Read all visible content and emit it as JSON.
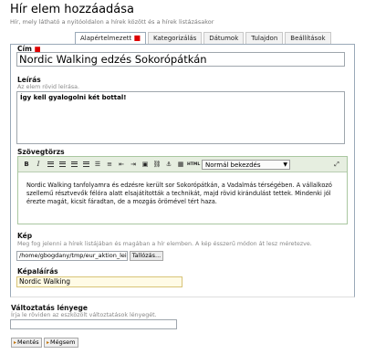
{
  "header": {
    "title": "Hír elem hozzáadása",
    "subtitle": "Hír, mely látható a nyitóoldalon a hírek között és a hírek listázásakor"
  },
  "tabs": [
    {
      "label": "Alapértelmezett",
      "active": true,
      "marker": "■"
    },
    {
      "label": "Kategorizálás"
    },
    {
      "label": "Dátumok"
    },
    {
      "label": "Tulajdon"
    },
    {
      "label": "Beállítások"
    }
  ],
  "form": {
    "title": {
      "label": "Cím",
      "required_marker": "■",
      "value": "Nordic Walking edzés Sokorópátkán"
    },
    "description": {
      "label": "Leírás",
      "help": "Az elem rövid leírása.",
      "value": "Így kell gyalogolni két bottal!"
    },
    "body": {
      "label": "Szövegtörzs",
      "format_select": "Normál bekezdés",
      "toolbar": {
        "bold": "B",
        "italic": "I",
        "html": "HTML"
      },
      "text": "Nordic Walking tanfolyamra és edzésre került sor Sokorópátkán, a Vadalmás térségében. A vállalkozó szellemű résztvevők félóra alatt elsajátították a technikát, majd rövid kirándulást tettek. Mindenki jól érezte magát, kicsit fáradtan, de a mozgás örömével tért haza."
    },
    "image": {
      "label": "Kép",
      "help": "Meg fog jelenni a hírek listájában és magában a hír elemben. A kép ésszerű módon át lesz méretezve.",
      "path": "/home/gbogdany/tmp/eur_aktion_leisu",
      "browse_label": "Tallózás..."
    },
    "caption": {
      "label": "Képaláírás",
      "value": "Nordic Walking"
    },
    "change_note": {
      "label": "Változtatás lényege",
      "help": "Írja le röviden az eszközölt változtatások lényegét.",
      "value": ""
    }
  },
  "buttons": {
    "save": "Mentés",
    "cancel": "Mégsem"
  }
}
